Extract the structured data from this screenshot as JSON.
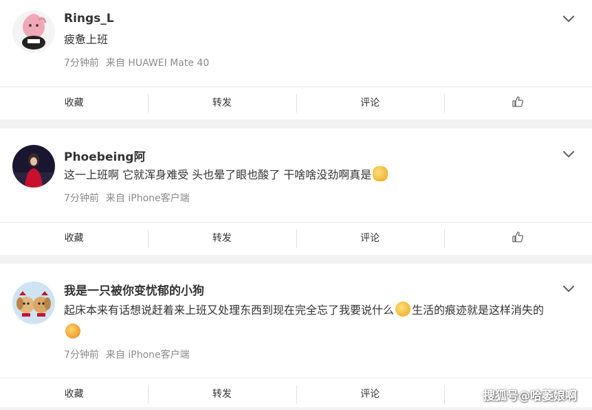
{
  "posts": [
    {
      "username": "Rings_L",
      "content": "疲惫上班",
      "time": "7分钟前",
      "source": "来自 HUAWEI Mate 40",
      "actions": {
        "favorite": "收藏",
        "repost": "转发",
        "comment": "评论"
      }
    },
    {
      "username": "Phoebeing阿",
      "content": "这一上班啊 它就浑身难受 头也晕了眼也酸了 干啥啥没劲啊真是",
      "time": "7分钟前",
      "source": "来自 iPhone客户端",
      "actions": {
        "favorite": "收藏",
        "repost": "转发",
        "comment": "评论"
      }
    },
    {
      "username": "我是一只被你变忧郁的小狗",
      "content_part1": "起床本来有话想说赶着来上班又处理东西到现在完全忘了我要说什么",
      "content_part2": "生活的痕迹就是这样消失的",
      "time": "7分钟前",
      "source": "来自 iPhone客户端",
      "actions": {
        "favorite": "收藏",
        "repost": "转发",
        "comment": "评论"
      }
    }
  ],
  "watermark": "搜狐号@哈萎娘啊",
  "icons": [
    "chevron-down-icon",
    "thumbs-up-icon"
  ],
  "colors": {
    "text": "#333333",
    "meta": "#8a8a8a",
    "background": "#f2f2f2",
    "card": "#ffffff"
  }
}
